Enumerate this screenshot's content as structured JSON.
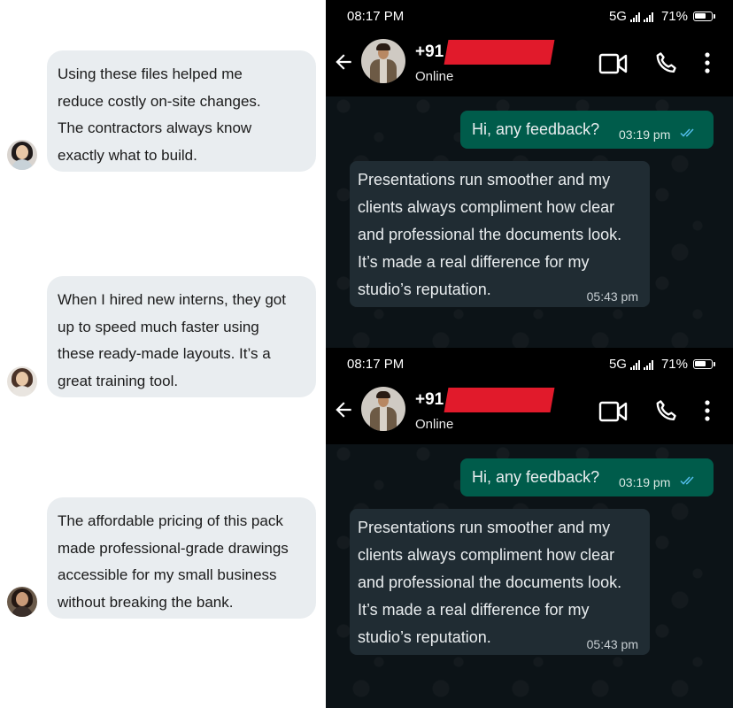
{
  "testimonials": [
    {
      "lines": [
        "Using these files helped me",
        "reduce costly on-site changes.",
        "The contractors always know",
        "exactly what to build."
      ]
    },
    {
      "lines": [
        "When I hired new interns, they got",
        "up to speed much faster using",
        "these ready-made layouts. It’s a",
        "great training tool."
      ]
    },
    {
      "lines": [
        "The affordable pricing of this pack",
        "made professional-grade drawings",
        "accessible for my small business",
        "without breaking the bank."
      ]
    }
  ],
  "phones": [
    {
      "status": {
        "time": "08:17 PM",
        "network": "5G",
        "battery": "71%"
      },
      "contact": {
        "name": "+91",
        "status": "Online"
      },
      "outgoing": {
        "text": "Hi, any feedback?",
        "time": "03:19 pm"
      },
      "incoming": {
        "lines": [
          "Presentations run smoother and my",
          "clients always compliment how clear",
          "and professional the documents look.",
          "It’s made a real difference for my",
          "studio’s reputation."
        ],
        "time": "05:43 pm"
      }
    },
    {
      "status": {
        "time": "08:17 PM",
        "network": "5G",
        "battery": "71%"
      },
      "contact": {
        "name": "+91",
        "status": "Online"
      },
      "outgoing": {
        "text": "Hi, any feedback?",
        "time": "03:19 pm"
      },
      "incoming": {
        "lines": [
          "Presentations run smoother and my",
          "clients always compliment how clear",
          "and professional the documents look.",
          "It’s made a real difference for my",
          "studio’s reputation."
        ],
        "time": "05:43 pm"
      }
    }
  ],
  "colors": {
    "outgoing_bubble": "#005c4b",
    "incoming_bubble": "#202c33",
    "testimonial_bubble": "#e9edf0",
    "read_ticks": "#53bdeb",
    "redaction": "#e11a2b"
  }
}
